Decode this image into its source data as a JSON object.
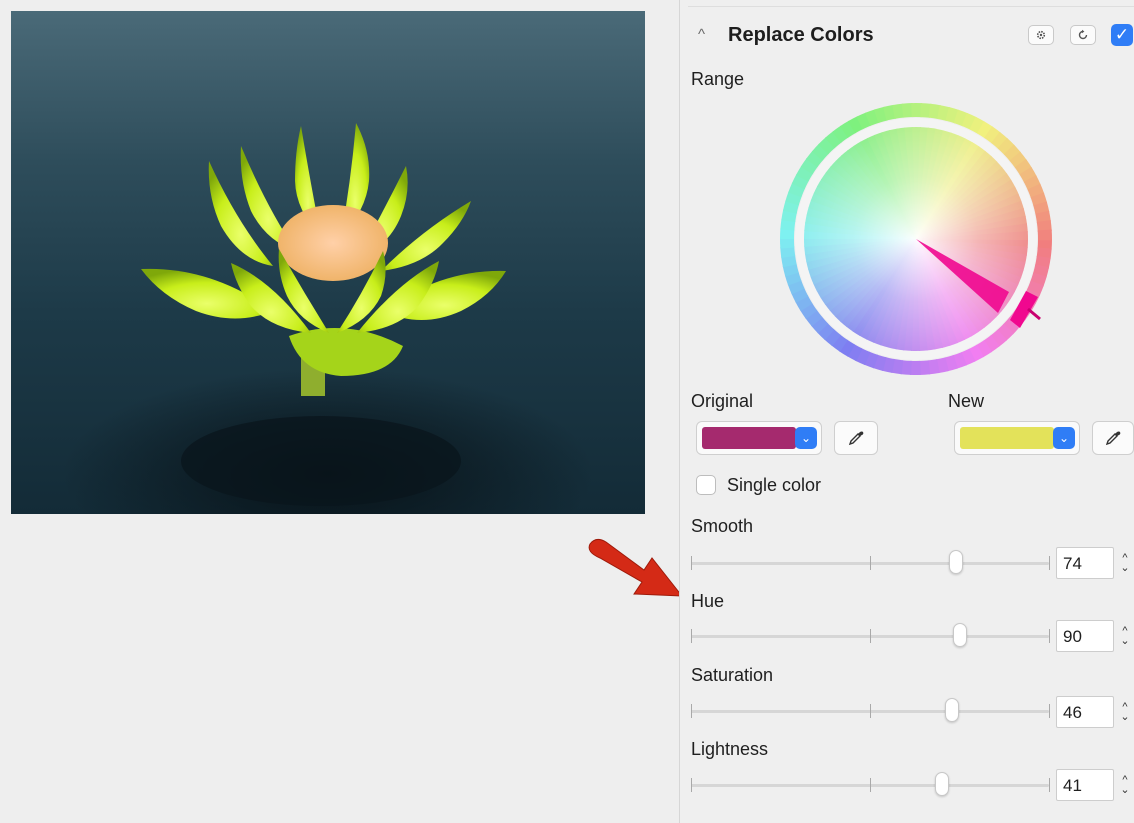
{
  "panel": {
    "title": "Replace Colors",
    "collapse_icon": "chevron-up-icon",
    "gear_icon": "gear-icon",
    "reset_icon": "reset-icon",
    "enabled": true
  },
  "range": {
    "label": "Range",
    "selected_hue_color": "#f0088f"
  },
  "original": {
    "label": "Original",
    "color": "#a52a6e"
  },
  "new": {
    "label": "New",
    "color": "#e3e25a"
  },
  "single_color": {
    "label": "Single color",
    "checked": false
  },
  "sliders": [
    {
      "label": "Smooth",
      "value": "74",
      "fraction": 0.74
    },
    {
      "label": "Hue",
      "value": "90",
      "fraction": 0.75
    },
    {
      "label": "Saturation",
      "value": "46",
      "fraction": 0.73
    },
    {
      "label": "Lightness",
      "value": "41",
      "fraction": 0.7
    }
  ],
  "annotation": {
    "arrow_color": "#d42a16"
  }
}
